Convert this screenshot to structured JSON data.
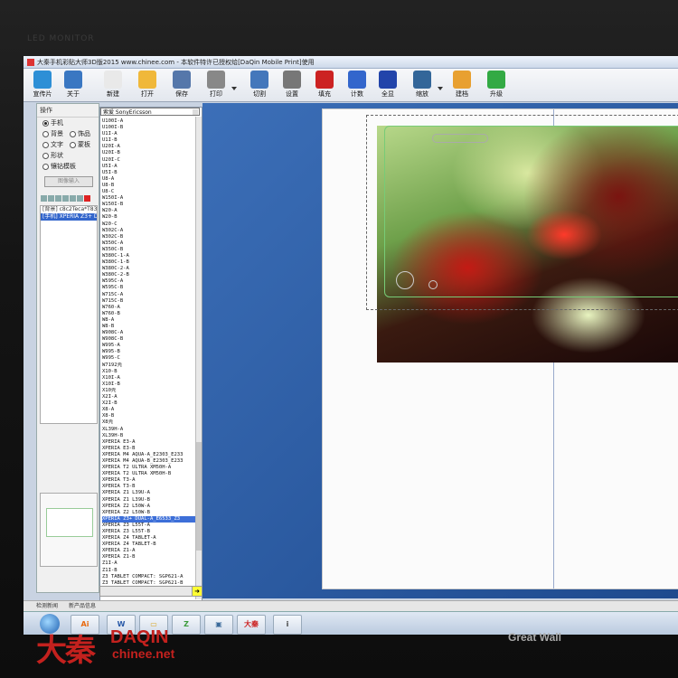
{
  "monitor": {
    "label": "LED MONITOR",
    "brand": "Great Wall"
  },
  "window": {
    "title": "大秦手机彩贴大师3D版2015 www.chinee.com - 本软件特许已授权给[DaQin Mobile Print]使用"
  },
  "toolbar": [
    {
      "label": "宣传片",
      "icon": "play-icon",
      "color": "#2d8fd6"
    },
    {
      "label": "关于",
      "icon": "info-icon",
      "color": "#3a77c2"
    },
    {
      "label": "新建",
      "icon": "new-file-icon",
      "color": "#e9e9e9"
    },
    {
      "label": "打开",
      "icon": "open-folder-icon",
      "color": "#f0b83a"
    },
    {
      "label": "保存",
      "icon": "save-icon",
      "color": "#5577aa"
    },
    {
      "label": "打印",
      "icon": "print-icon",
      "color": "#888888"
    },
    {
      "label": "切割",
      "icon": "cut-plotter-icon",
      "color": "#4477bb"
    },
    {
      "label": "设置",
      "icon": "settings-icon",
      "color": "#777777"
    },
    {
      "label": "填充",
      "icon": "fill-icon",
      "color": "#cc2222"
    },
    {
      "label": "计数",
      "icon": "count-icon",
      "color": "#3366cc"
    },
    {
      "label": "全显",
      "icon": "fit-screen-icon",
      "color": "#2244aa"
    },
    {
      "label": "缩放",
      "icon": "zoom-icon",
      "color": "#336699"
    },
    {
      "label": "建档",
      "icon": "archive-icon",
      "color": "#e8a030"
    },
    {
      "label": "升级",
      "icon": "upgrade-icon",
      "color": "#33aa44"
    }
  ],
  "left_panel": {
    "title": "操作",
    "options": [
      {
        "label": "手机",
        "checked": true
      },
      {
        "label": "背景",
        "checked": false
      },
      {
        "label": "饰品",
        "checked": false
      },
      {
        "label": "文字",
        "checked": false
      },
      {
        "label": "蒙板",
        "checked": false
      },
      {
        "label": "形状",
        "checked": false
      },
      {
        "label": "镶钻模板",
        "checked": false
      }
    ],
    "import_button": "图像输入",
    "layers": [
      {
        "text": "[背景] c8c2Teca*T83b",
        "selected": false
      },
      {
        "text": "[手机] XPERIA Z3+ DU",
        "selected": true
      }
    ]
  },
  "model_panel": {
    "brand": "索爱  SonyEricsson",
    "models": [
      "U100I-A",
      "U100I-B",
      "U1I-A",
      "U1I-B",
      "U20I-A",
      "U20I-B",
      "U20I-C",
      "U5I-A",
      "U5I-B",
      "U8-A",
      "U8-B",
      "U8-C",
      "W150I-A",
      "W150I-B",
      "W20-A",
      "W20-B",
      "W20-C",
      "W302C-A",
      "W302C-B",
      "W350C-A",
      "W350C-B",
      "W380C-1-A",
      "W380C-1-B",
      "W380C-2-A",
      "W380C-2-B",
      "W595C-A",
      "W595C-B",
      "W715C-A",
      "W715C-B",
      "W760-A",
      "W760-B",
      "W8-A",
      "W8-B",
      "W908C-A",
      "W908C-B",
      "W995-A",
      "W995-B",
      "W995-C",
      "W7192壳",
      "X10-B",
      "X10I-A",
      "X10I-B",
      "X10壳",
      "X2I-A",
      "X2I-B",
      "X8-A",
      "X8-B",
      "X8壳",
      "XL39H-A",
      "XL39H-B",
      "XPERIA E3-A",
      "XPERIA E3-B",
      "XPERIA M4 AQUA-A_E2303_E233",
      "XPERIA M4 AQUA-B_E2303_E233",
      "XPERIA T2 ULTRA XM50H-A",
      "XPERIA T2 ULTRA XM50H-B",
      "XPERIA T3-A",
      "XPERIA T3-B",
      "XPERIA Z1 L39U-A",
      "XPERIA Z1 L39U-B",
      "XPERIA Z2 L50W-A",
      "XPERIA Z2 L50W-B",
      "XPERIA Z3+ DUAL-A_E6533_Z3",
      "XPERIA Z3 L55T-A",
      "XPERIA Z3 L55T-B",
      "XPERIA Z4 TABLET-A",
      "XPERIA Z4 TABLET-B",
      "XPERIA Z1-A",
      "XPERIA Z1-B",
      "Z1I-A",
      "Z1I-B",
      "Z3 TABLET COMPACT: SGP621-A",
      "Z3 TABLET COMPACT: SGP621-B"
    ],
    "selected_index": 62
  },
  "statusbar": {
    "items": [
      "检测新闻",
      "新产品信息"
    ]
  },
  "taskbar": [
    {
      "name": "start-orb",
      "label": ""
    },
    {
      "name": "illustrator",
      "label": "Ai",
      "color": "#e86a10"
    },
    {
      "name": "word",
      "label": "W",
      "color": "#2a5aa8"
    },
    {
      "name": "explorer",
      "label": "▭",
      "color": "#d9a520"
    },
    {
      "name": "app-green",
      "label": "Z",
      "color": "#3a9a3a"
    },
    {
      "name": "image-viewer",
      "label": "▣",
      "color": "#3a6a9a"
    },
    {
      "name": "daqin-app",
      "label": "大秦",
      "color": "#cc2222"
    },
    {
      "name": "installer",
      "label": "i",
      "color": "#444444"
    }
  ],
  "watermark": {
    "chinese": "大秦",
    "english": "DAQIN",
    "url": "chinee.net"
  }
}
